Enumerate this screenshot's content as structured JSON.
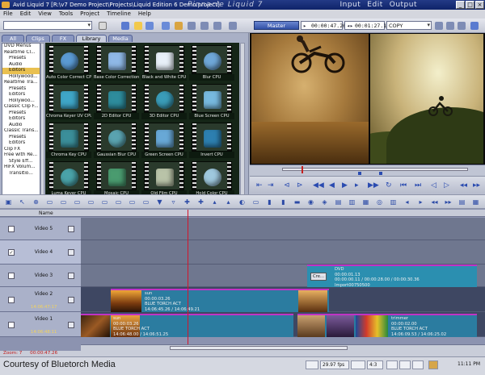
{
  "window": {
    "title": "Avid Liquid 7 [R:\\v7 Demo Project\\Projects\\Liquid Edition 6 Demo.project]",
    "brand": "Pinnacle Liquid 7",
    "modes": [
      "Input",
      "Edit",
      "Output"
    ],
    "controls": [
      "_",
      "□",
      "×"
    ]
  },
  "menubar": [
    "File",
    "Edit",
    "View",
    "Tools",
    "Project",
    "Timeline",
    "Help"
  ],
  "toolbar": {
    "master_label": "Master",
    "timecode_in": "00:00:47.26",
    "timecode_dur": "00:01:27.19",
    "copy_label": "COPY"
  },
  "library": {
    "tabs": [
      "All",
      "Clips",
      "FX",
      "Library",
      "Media"
    ],
    "active_tab": "Library",
    "tree": [
      "DVD Menus",
      "Realtime Cl...",
      "Presets",
      "Audio",
      "Editors",
      "Hollywood...",
      "Realtime Tra...",
      "Presets",
      "Editors",
      "Hollywoo...",
      "Classic Clip F...",
      "Presets",
      "Editors",
      "Audio",
      "Classic Trans...",
      "Presets",
      "Editors",
      "Clip FX",
      "Free with Re...",
      "Style Eff...",
      "HiFX Volum...",
      "Transitio..."
    ],
    "selected_tree_index": 4,
    "tiles": [
      "Auto Color Correct CPU",
      "Base Color Correction",
      "Black and White CPU",
      "Blur CPU",
      "Chroma Keyer UV CPU",
      "2D Editor CPU",
      "3D Editor CPU",
      "Blue Screen CPU",
      "Chroma Key CPU",
      "Gaussian Blur CPU",
      "Green Screen CPU",
      "Invert CPU",
      "Luma Keyer CPU",
      "Mosaic CPU",
      "Old Film CPU",
      "Hold Color CPU"
    ]
  },
  "timeline": {
    "header": "Name",
    "tracks": [
      {
        "label": "Video 5",
        "tc": ""
      },
      {
        "label": "Video 4",
        "tc": ""
      },
      {
        "label": "Video 3",
        "tc": ""
      },
      {
        "label": "Video 2",
        "tc": "14:06:47:17"
      },
      {
        "label": "Video 1",
        "tc": "14:06:48:11"
      }
    ],
    "clips": {
      "v3": {
        "name": "DVD",
        "l1": "00:00:01.13",
        "l2": "00:00:00.11 / 00:00:28.00 / 00:00:30.36",
        "l3": "Import00750500",
        "badge": "Cre..."
      },
      "v2": {
        "name": "sun",
        "l1": "00:00:03.26",
        "l2": "BLUE TORCH ACT",
        "l3": "14:06:45.26 / 14:06:49.21"
      },
      "v1a": {
        "name": "sun",
        "l1": "00:00:03.26",
        "l2": "BLUE TORCH ACT",
        "l3": "14:06:48.00 / 14:06:51.25"
      },
      "v1b": {
        "name": "trimmer",
        "l1": "00:00:02.00",
        "l2": "BLUE TORCH ACT",
        "l3": "14:06:09.53 / 14:06:25.02"
      }
    },
    "zoom_label": "Zoom: 7",
    "zoom_tc": "00:00:47.26"
  },
  "status": {
    "credit": "Courtesy of Bluetorch Media",
    "boxes": [
      "",
      "29.97 fps",
      "",
      "4:3"
    ],
    "clock": "11:11 PM"
  }
}
